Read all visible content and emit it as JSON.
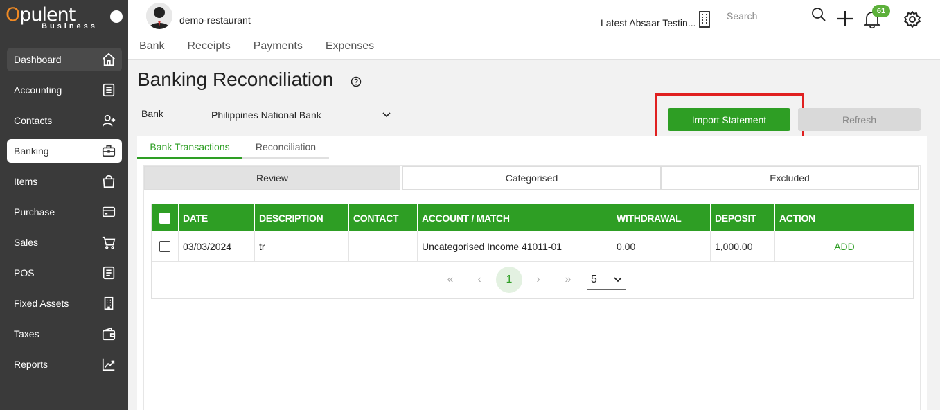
{
  "sidebar": {
    "logo": {
      "main": "pulent",
      "sub": "Business"
    },
    "items": [
      {
        "label": "Dashboard",
        "icon": "home-icon"
      },
      {
        "label": "Accounting",
        "icon": "ledger-icon"
      },
      {
        "label": "Contacts",
        "icon": "user-plus-icon"
      },
      {
        "label": "Banking",
        "icon": "briefcase-icon"
      },
      {
        "label": "Items",
        "icon": "shopping-bag-icon"
      },
      {
        "label": "Purchase",
        "icon": "credit-card-icon"
      },
      {
        "label": "Sales",
        "icon": "cart-icon"
      },
      {
        "label": "POS",
        "icon": "receipt-icon"
      },
      {
        "label": "Fixed Assets",
        "icon": "building-icon"
      },
      {
        "label": "Taxes",
        "icon": "wallet-icon"
      },
      {
        "label": "Reports",
        "icon": "chart-line-icon"
      }
    ]
  },
  "header": {
    "org_name": "demo-restaurant",
    "company": "Latest Absaar Testin...",
    "search_placeholder": "Search",
    "notification_count": "61",
    "tabs": [
      "Bank",
      "Receipts",
      "Payments",
      "Expenses"
    ]
  },
  "page": {
    "title": "Banking Reconciliation",
    "bank_label": "Bank",
    "bank_value": "Philippines National Bank",
    "import_label": "Import Statement",
    "refresh_label": "Refresh",
    "sub_tabs": [
      "Bank Transactions",
      "Reconciliation"
    ],
    "segments": [
      "Review",
      "Categorised",
      "Excluded"
    ]
  },
  "table": {
    "columns": [
      "DATE",
      "DESCRIPTION",
      "CONTACT",
      "ACCOUNT / MATCH",
      "WITHDRAWAL",
      "DEPOSIT",
      "ACTION"
    ],
    "rows": [
      {
        "date": "03/03/2024",
        "description": "tr",
        "contact": "",
        "account": "Uncategorised Income 41011-01",
        "withdrawal": "0.00",
        "deposit": "1,000.00",
        "action": "ADD"
      }
    ]
  },
  "pagination": {
    "first": "«",
    "prev": "‹",
    "current": "1",
    "next": "›",
    "last": "»",
    "page_size": "5"
  },
  "colors": {
    "accent": "#2e9e24",
    "sidebar": "#3a3a3a",
    "highlight": "#e02020"
  }
}
